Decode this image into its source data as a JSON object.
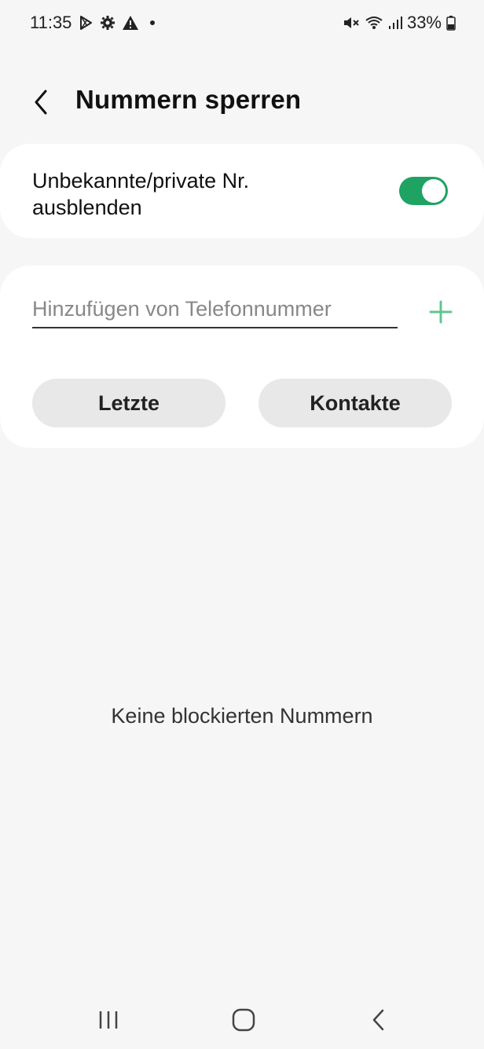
{
  "status_bar": {
    "time": "11:35",
    "battery": "33%",
    "icons_left": [
      "play-store-icon",
      "settings-gear-icon",
      "warning-icon",
      "dot-icon"
    ],
    "icons_right": [
      "mute-icon",
      "wifi-icon",
      "signal-icon",
      "battery-icon"
    ]
  },
  "header": {
    "title": "Nummern sperren"
  },
  "unknown_numbers": {
    "label": "Unbekannte/private Nr. ausblenden",
    "enabled": true
  },
  "add_number": {
    "placeholder": "Hinzufügen von Telefonnummer",
    "value": "",
    "recent_label": "Letzte",
    "contacts_label": "Kontakte"
  },
  "empty_state": {
    "text": "Keine blockierten Nummern"
  },
  "colors": {
    "accent": "#1ea362",
    "plus": "#5fc68f",
    "background": "#f6f6f6",
    "card": "#ffffff",
    "pill": "#e8e8e8"
  }
}
